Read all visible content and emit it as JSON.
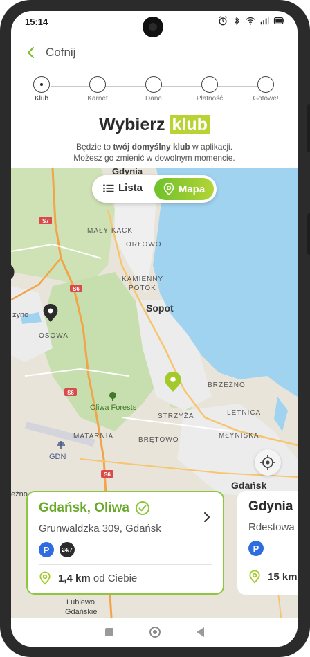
{
  "statusbar": {
    "time": "15:14"
  },
  "header": {
    "back_label": "Cofnij"
  },
  "stepper": {
    "steps": [
      {
        "label": "Klub"
      },
      {
        "label": "Karnet"
      },
      {
        "label": "Dane"
      },
      {
        "label": "Płatność"
      },
      {
        "label": "Gotowe!"
      }
    ],
    "active_index": 0
  },
  "title": {
    "prefix": "Wybierz",
    "highlight": "klub"
  },
  "subtitle": {
    "line1_pre": "Będzie to ",
    "line1_bold": "twój domyślny klub",
    "line1_post": " w aplikacji.",
    "line2": "Możesz go zmienić w dowolnym momencie."
  },
  "view_toggle": {
    "list_label": "Lista",
    "map_label": "Mapa",
    "selected": "Mapa"
  },
  "map": {
    "labels": {
      "gdynia_top": "Gdynia",
      "maly_kack": "MAŁY KACK",
      "orlowo": "ORŁOWO",
      "kamienny_potok_1": "KAMIENNY",
      "kamienny_potok_2": "POTOK",
      "sopot": "Sopot",
      "osowa": "OSOWA",
      "zyno": "żyno",
      "brzezno": "BRZEŹNO",
      "letnica": "LETNICA",
      "strzyza": "STRZYŻA",
      "oliwa_forests": "Oliwa Forests",
      "matarnia": "MATARNIA",
      "bretowo": "BRĘTOWO",
      "mlyniska": "MŁYNISKA",
      "gdn": "GDN",
      "gdansk": "Gdańsk",
      "lezno": "eżno",
      "lublewo_1": "Lublewo",
      "lublewo_2": "Gdańskie"
    },
    "roads": {
      "s7": "S7",
      "s6_a": "S6",
      "s6_b": "S6",
      "s6_c": "S6"
    },
    "colors": {
      "land": "#e8e4da",
      "sea": "#9fd3f0",
      "forest": "#c7dfae",
      "urban": "#ececec",
      "road_major": "#f2a44a",
      "pin_selected": "#a4c92a",
      "pin_other": "#2b2b2b"
    }
  },
  "club_cards": [
    {
      "name": "Gdańsk, Oliwa",
      "address": "Grunwaldzka 309, Gdańsk",
      "badges": [
        "P",
        "24/7"
      ],
      "distance": "1,4 km",
      "distance_suffix": "od Ciebie",
      "selected": true
    },
    {
      "name": "Gdynia",
      "address": "Rdestowa",
      "badges": [
        "P"
      ],
      "distance": "15 km",
      "distance_suffix": "",
      "selected": false
    }
  ],
  "colors": {
    "accent": "#8ec63f",
    "accent_text": "#6aa92b",
    "title_highlight": "#b9d334",
    "parking_badge": "#2f6ce0"
  }
}
